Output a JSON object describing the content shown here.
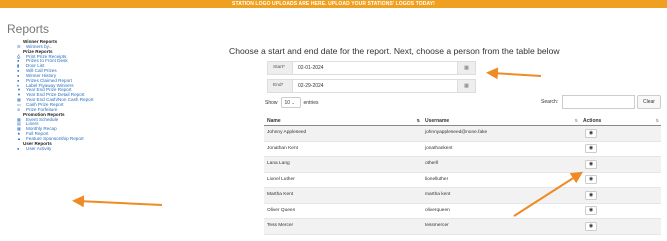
{
  "banner": "STATION LOGO UPLOADS ARE HERE. UPLOAD YOUR STATIONS' LOGOS TODAY!",
  "page_title": "Reports",
  "sidebar": [
    {
      "type": "heading",
      "label": "Winner Reports"
    },
    {
      "type": "item",
      "icon": "list-icon",
      "glyph": "☰",
      "label": "Winners by..."
    },
    {
      "type": "heading",
      "label": "Prize Reports"
    },
    {
      "type": "item",
      "icon": "print-icon",
      "glyph": "⎙",
      "label": "Print Prize Receipts"
    },
    {
      "type": "item",
      "icon": "prize-icon",
      "glyph": "●",
      "label": "Prizes to Front Desk"
    },
    {
      "type": "item",
      "icon": "door-icon",
      "glyph": "▮",
      "label": "Door List"
    },
    {
      "type": "item",
      "icon": "info-icon",
      "glyph": "●",
      "label": "Will Call Prizes"
    },
    {
      "type": "item",
      "icon": "info-icon",
      "glyph": "●",
      "label": "Winner History"
    },
    {
      "type": "item",
      "icon": "info-icon",
      "glyph": "●",
      "label": "Prizes Claimed Report"
    },
    {
      "type": "item",
      "icon": "map-marker-icon",
      "glyph": "♦",
      "label": "Label Flyaway Winners"
    },
    {
      "type": "item",
      "icon": "trophy-icon",
      "glyph": "▼",
      "label": "Year End Prize Report"
    },
    {
      "type": "item",
      "icon": "trophy-icon",
      "glyph": "▼",
      "label": "Year End Prize Detail Report"
    },
    {
      "type": "item",
      "icon": "calendar-icon",
      "glyph": "▦",
      "label": "Year End Cash/Non Cash Report"
    },
    {
      "type": "item",
      "icon": "money-icon",
      "glyph": "▭",
      "label": "Cash Prize Report"
    },
    {
      "type": "item",
      "icon": "forfeit-icon",
      "glyph": "⊘",
      "label": "Prize Forfeiture"
    },
    {
      "type": "heading",
      "label": "Promotion Reports"
    },
    {
      "type": "item",
      "icon": "calendar-icon",
      "glyph": "▦",
      "label": "Event Schedule"
    },
    {
      "type": "item",
      "icon": "liners-icon",
      "glyph": "▤",
      "label": "Liners"
    },
    {
      "type": "item",
      "icon": "calendar-icon",
      "glyph": "▦",
      "label": "Monthly Recap"
    },
    {
      "type": "item",
      "icon": "star-icon",
      "glyph": "★",
      "label": "Full Report"
    },
    {
      "type": "item",
      "icon": "sponsor-icon",
      "glyph": "▲",
      "label": "Feature Sponsorship Report"
    },
    {
      "type": "heading",
      "label": "User Reports"
    },
    {
      "type": "item",
      "icon": "user-icon",
      "glyph": "●",
      "label": "User Activity"
    }
  ],
  "instructions": "Choose a start and end date for the report. Next, choose a person from the table below",
  "dates": {
    "start_label": "Start*",
    "start_value": "02-01-2024",
    "end_label": "End*",
    "end_value": "02-29-2024"
  },
  "table_controls": {
    "show_label": "Show",
    "show_value": "10",
    "entries_label": "entries",
    "search_label": "Search:",
    "search_value": "",
    "clear_label": "Clear"
  },
  "table": {
    "headers": [
      "Name",
      "Username",
      "Actions"
    ],
    "rows": [
      {
        "name": "Johnny Appleseed",
        "username": "johnnyappleseed@none.fake"
      },
      {
        "name": "Jonathan Kent",
        "username": "jonathankent"
      },
      {
        "name": "Lana Lang",
        "username": "otherll"
      },
      {
        "name": "Lionel Luther",
        "username": "lionelluther"
      },
      {
        "name": "Martha Kent",
        "username": "martha kent"
      },
      {
        "name": "Oliver Queen",
        "username": "oliverqueen"
      },
      {
        "name": "Tess Mercer",
        "username": "tessmercer"
      }
    ]
  },
  "colors": {
    "banner": "#f0a020",
    "link": "#2a6ebb",
    "arrow": "#f08a24"
  }
}
